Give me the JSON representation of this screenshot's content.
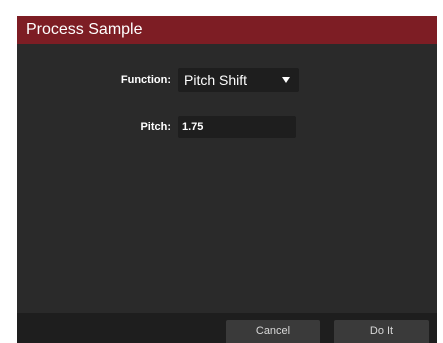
{
  "dialog": {
    "title": "Process Sample",
    "title_color": "#7d1d24",
    "background_color": "#2a2a2a"
  },
  "function_row": {
    "label": "Function:",
    "selected_value": "Pitch Shift",
    "icon": "chevron-down-icon"
  },
  "pitch_row": {
    "label": "Pitch:",
    "value": "1.75"
  },
  "footer": {
    "cancel_label": "Cancel",
    "doit_label": "Do It"
  }
}
